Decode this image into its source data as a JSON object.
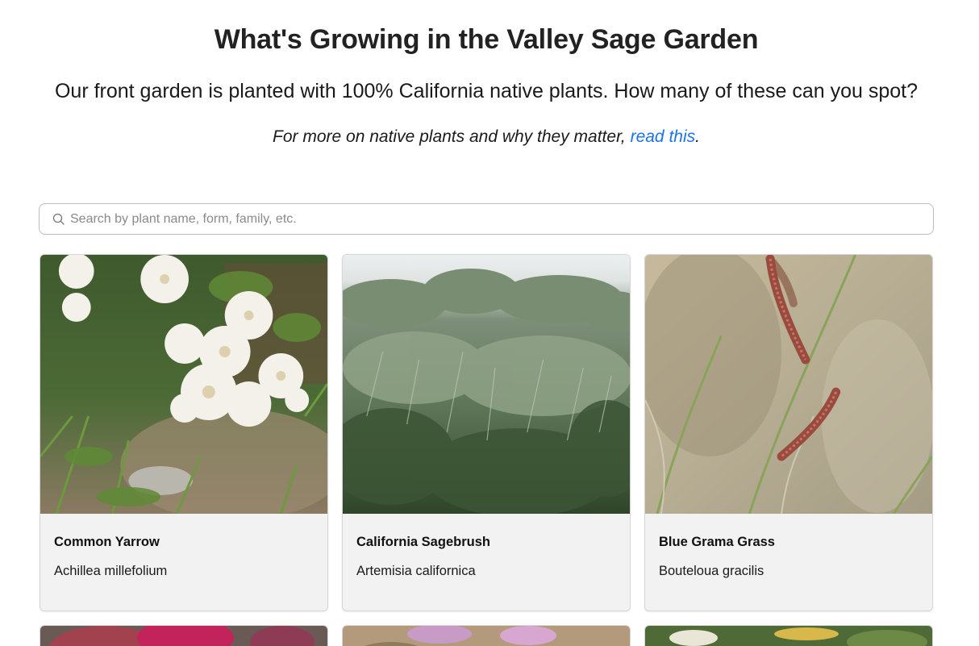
{
  "header": {
    "title": "What's Growing in the Valley Sage Garden",
    "intro": "Our front garden is planted with 100% California native plants. How many of these can you spot?",
    "more_info_prefix": "For more on native plants and why they matter, ",
    "more_info_link": "read this",
    "more_info_suffix": "."
  },
  "search": {
    "placeholder": "Search by plant name, form, family, etc.",
    "value": ""
  },
  "plants": [
    {
      "common_name": "Common Yarrow",
      "scientific_name": "Achillea millefolium"
    },
    {
      "common_name": "California Sagebrush",
      "scientific_name": "Artemisia californica"
    },
    {
      "common_name": "Blue Grama Grass",
      "scientific_name": "Bouteloua gracilis"
    }
  ],
  "colors": {
    "link": "#1a73e8",
    "card_background": "#f2f2f2",
    "card_border": "#d6d6d6"
  }
}
